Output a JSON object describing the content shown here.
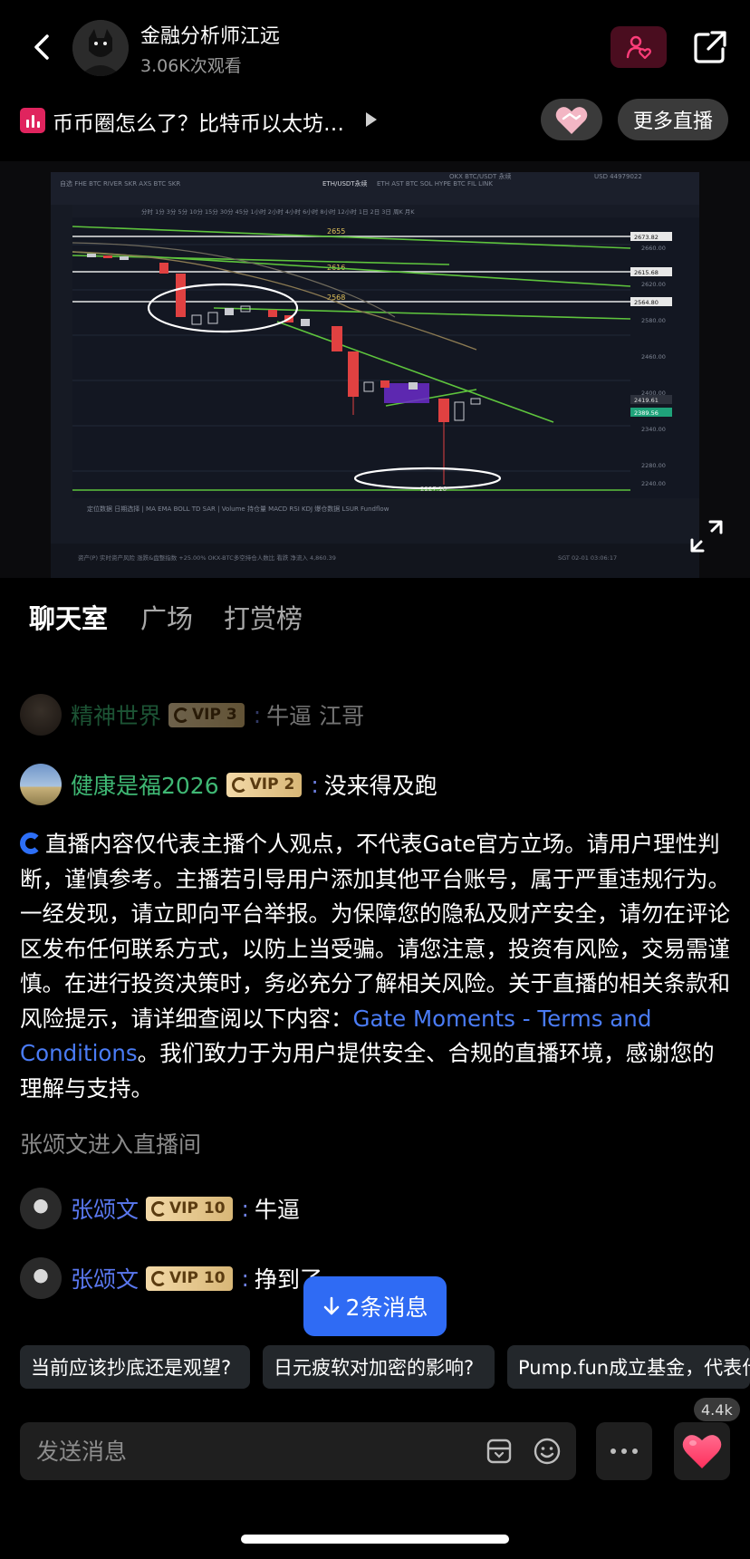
{
  "header": {
    "host_name": "金融分析师江远",
    "views": "3.06K次观看",
    "stream_title": "币币圈怎么了？比特币以太坊…",
    "more_live_label": "更多直播",
    "icons": {
      "back": "chevron-left-icon",
      "follow": "user-heart-icon",
      "share": "share-icon",
      "gift": "handshake-heart-icon"
    },
    "accent_color": "#e0245e"
  },
  "video": {
    "description": "ETH/USDT candlestick chart stream with drawn levels",
    "levels": [
      "2655",
      "2616",
      "2568"
    ],
    "price_tags": [
      "2673.82",
      "2615.68",
      "2564.80",
      "2419.61",
      "2389.56"
    ],
    "low_label": "2227.16",
    "pair_label": "ETH/USDT永续"
  },
  "tabs": [
    {
      "label": "聊天室",
      "active": true
    },
    {
      "label": "广场",
      "active": false
    },
    {
      "label": "打赏榜",
      "active": false
    }
  ],
  "chat": [
    {
      "user": "精神世界",
      "vip": "VIP 3",
      "message": "牛逼 江哥",
      "name_color": "#3fb874",
      "faded": true
    },
    {
      "user": "健康是福2026",
      "vip": "VIP 2",
      "message": "没来得及跑",
      "name_color": "#3fb874",
      "faded": false
    },
    {
      "user": "张颂文",
      "vip": "VIP 10",
      "message": "牛逼",
      "name_color": "#5a78f0",
      "faded": false
    },
    {
      "user": "张颂文",
      "vip": "VIP 10",
      "message": "挣到了",
      "name_color": "#5a78f0",
      "faded": false
    }
  ],
  "notice": {
    "text_before": "直播内容仅代表主播个人观点，不代表Gate官方立场。请用户理性判断，谨慎参考。主播若引导用户添加其他平台账号，属于严重违规行为。一经发现，请立即向平台举报。为保障您的隐私及财产安全，请勿在评论区发布任何联系方式，以防上当受骗。请您注意，投资有风险，交易需谨慎。在进行投资决策时，务必充分了解相关风险。关于直播的相关条款和风险提示，请详细查阅以下内容：",
    "link": "Gate Moments - Terms and Conditions",
    "text_after": "。我们致力于为用户提供安全、合规的直播环境，感谢您的理解与支持。"
  },
  "system_message": "张颂文进入直播间",
  "new_messages_button": "2条消息",
  "suggestions": [
    "当前应该抄底还是观望?",
    "日元疲软对加密的影响?",
    "Pump.fun成立基金，代表什么"
  ],
  "input": {
    "placeholder": "发送消息"
  },
  "likes": "4.4k"
}
